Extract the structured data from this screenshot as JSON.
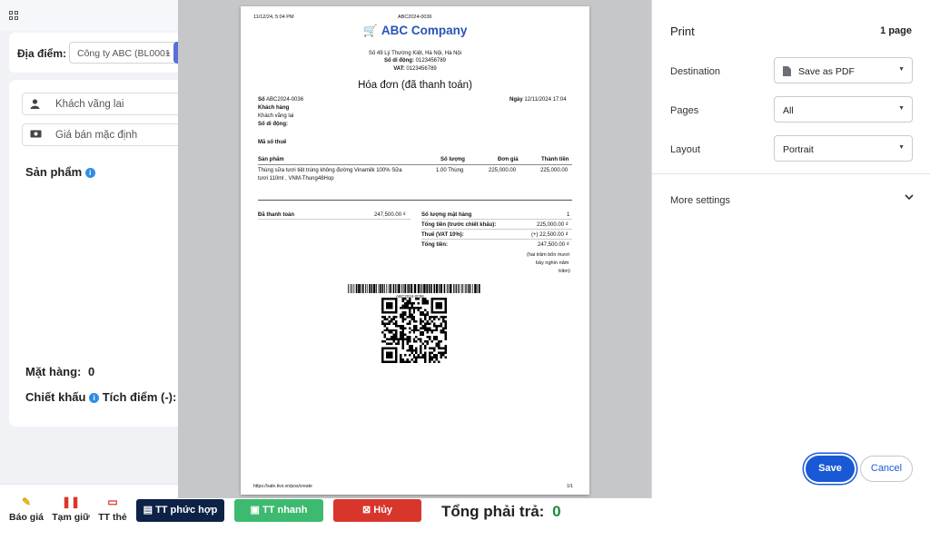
{
  "pos": {
    "location_label": "Địa điểm:",
    "location_value": "Công ty ABC (BL0001",
    "customer_placeholder": "Khách vãng lai",
    "price_placeholder": "Giá bán mặc định",
    "products_label": "Sản phẩm",
    "items_label": "Mặt hàng:",
    "items_count": "0",
    "discount_label": "Chiết khấu",
    "points_label": "Tích điểm (-):",
    "bottom": {
      "quote": "Báo giá",
      "hold": "Tạm giữ",
      "card": "TT thẻ",
      "complex_pay": "TT phức hợp",
      "quick_pay": "TT nhanh",
      "cancel": "Hủy",
      "total_label": "Tổng phải trả:",
      "total_value": "0"
    },
    "colors": {
      "complex_pay": "#0e2247",
      "quick_pay": "#3dba6f",
      "cancel": "#d9362b",
      "total": "#1e8a3a"
    }
  },
  "invoice": {
    "print_datetime": "11/12/24, 5:04 PM",
    "print_header_code": "ABC2024-0036",
    "company": "ABC Company",
    "address": "Số 49 Lý Thường Kiệt, Hà Nội, Hà Nội",
    "phone_label": "Số di động:",
    "phone": "0123456789",
    "vat_label": "VAT:",
    "vat": "0123456789",
    "title": "Hóa đơn (đã thanh toán)",
    "number_label": "Số",
    "number": "ABC2024-0036",
    "date_label": "Ngày",
    "date": "12/11/2024 17:04",
    "customer_label": "Khách hàng",
    "customer": "Khách vãng lai",
    "customer_phone_label": "Số di động:",
    "tax_code_label": "Mã số thuế",
    "table_headers": [
      "Sản phẩm",
      "Số lượng",
      "Đơn giá",
      "Thành tiền"
    ],
    "item": {
      "name_line1": "Thùng sữa tươi tiệt trùng không đường Vinamilk 100% Sữa",
      "name_line2": "tươi 110ml , VNM-Thung48Hop",
      "qty": "1.00 Thùng",
      "price": "225,000.00",
      "amount": "225,000.00"
    },
    "paid_label": "Đã thanh toán",
    "paid_value": "247,500.00 ₫",
    "summary": [
      {
        "label": "Số lượng mặt hàng",
        "value": "1"
      },
      {
        "label": "Tổng tiền (trước chiết khấu):",
        "value": "225,000.00 ₫"
      },
      {
        "label": "Thuế (VAT 10%):",
        "value": "(+) 22,500.00 ₫"
      },
      {
        "label": "Tổng tiền:",
        "value": "247,500.00 ₫"
      }
    ],
    "amount_words_1": "(hai trăm bốn mươi",
    "amount_words_2": "bảy nghìn năm",
    "amount_words_3": "trăm)",
    "barcode_text": "ABC2024-0036",
    "footer_url": "https://sale.tivo.vn/pos/create",
    "footer_page": "1/1"
  },
  "print_panel": {
    "title": "Print",
    "page_count": "1 page",
    "destination_label": "Destination",
    "destination_value": "Save as PDF",
    "pages_label": "Pages",
    "pages_value": "All",
    "layout_label": "Layout",
    "layout_value": "Portrait",
    "more_settings": "More settings",
    "save": "Save",
    "cancel": "Cancel",
    "accent": "#1a59d5"
  }
}
